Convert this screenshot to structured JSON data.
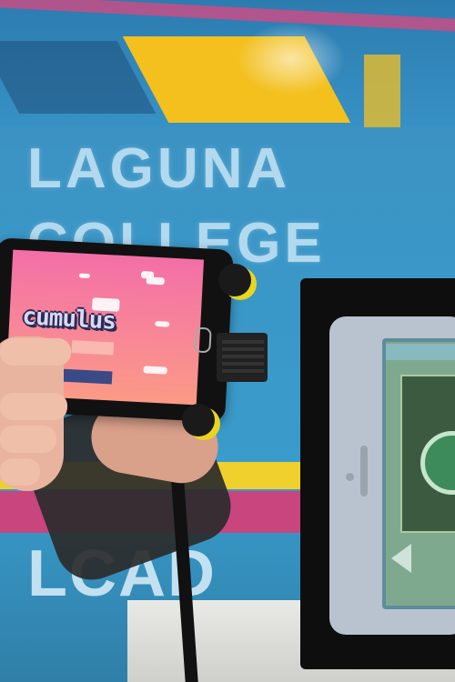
{
  "banner": {
    "line1": "LAGUNA",
    "line2": "COLLEGE",
    "logo": "LCAD"
  },
  "tablet_game": {
    "title": "cumulus"
  },
  "colors": {
    "banner_blue": "#3a97c7",
    "banner_yellow": "#f3c01e",
    "banner_pink": "#c8457e",
    "game_sky_top": "#f36fa7",
    "game_sky_bottom": "#fb9a86",
    "title_outline": "#2a2a55",
    "clamp_yellow": "#e9d51f"
  }
}
